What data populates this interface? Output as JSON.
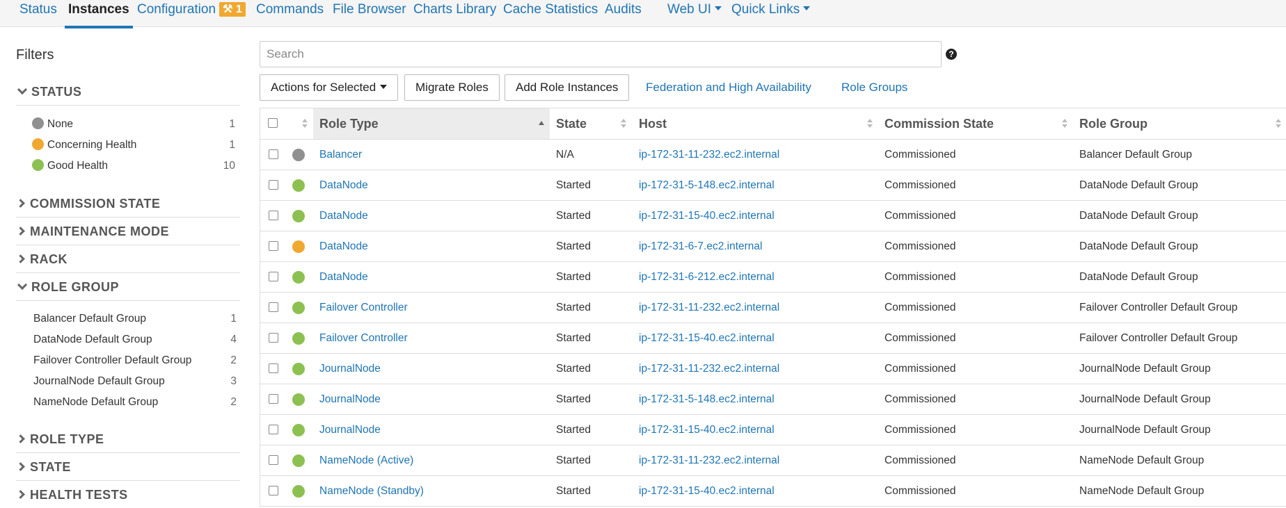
{
  "nav": {
    "tabs": [
      {
        "label": "Status"
      },
      {
        "label": "Instances"
      },
      {
        "label": "Configuration",
        "badge": "1"
      },
      {
        "label": "Commands"
      },
      {
        "label": "File Browser"
      },
      {
        "label": "Charts Library"
      },
      {
        "label": "Cache Statistics"
      },
      {
        "label": "Audits"
      },
      {
        "label": "Web UI"
      },
      {
        "label": "Quick Links"
      }
    ]
  },
  "filters": {
    "title": "Filters",
    "sections": [
      {
        "label": "STATUS"
      },
      {
        "label": "COMMISSION STATE"
      },
      {
        "label": "MAINTENANCE MODE"
      },
      {
        "label": "RACK"
      },
      {
        "label": "ROLE GROUP"
      },
      {
        "label": "ROLE TYPE"
      },
      {
        "label": "STATE"
      },
      {
        "label": "HEALTH TESTS"
      }
    ],
    "status_items": [
      {
        "label": "None",
        "count": "1"
      },
      {
        "label": "Concerning Health",
        "count": "1"
      },
      {
        "label": "Good Health",
        "count": "10"
      }
    ],
    "role_group_items": [
      {
        "label": "Balancer Default Group",
        "count": "1"
      },
      {
        "label": "DataNode Default Group",
        "count": "4"
      },
      {
        "label": "Failover Controller Default Group",
        "count": "2"
      },
      {
        "label": "JournalNode Default Group",
        "count": "3"
      },
      {
        "label": "NameNode Default Group",
        "count": "2"
      }
    ]
  },
  "search": {
    "placeholder": "Search"
  },
  "toolbar": {
    "actions_label": "Actions for Selected",
    "migrate_label": "Migrate Roles",
    "add_label": "Add Role Instances",
    "federation_label": "Federation and High Availability",
    "role_groups_label": "Role Groups"
  },
  "table": {
    "headers": {
      "role_type": "Role Type",
      "state": "State",
      "host": "Host",
      "commission_state": "Commission State",
      "role_group": "Role Group"
    },
    "rows": [
      {
        "status": "none",
        "role_type": "Balancer",
        "state": "N/A",
        "host": "ip-172-31-11-232.ec2.internal",
        "commission_state": "Commissioned",
        "role_group": "Balancer Default Group"
      },
      {
        "status": "good",
        "role_type": "DataNode",
        "state": "Started",
        "host": "ip-172-31-5-148.ec2.internal",
        "commission_state": "Commissioned",
        "role_group": "DataNode Default Group"
      },
      {
        "status": "good",
        "role_type": "DataNode",
        "state": "Started",
        "host": "ip-172-31-15-40.ec2.internal",
        "commission_state": "Commissioned",
        "role_group": "DataNode Default Group"
      },
      {
        "status": "concerning",
        "role_type": "DataNode",
        "state": "Started",
        "host": "ip-172-31-6-7.ec2.internal",
        "commission_state": "Commissioned",
        "role_group": "DataNode Default Group"
      },
      {
        "status": "good",
        "role_type": "DataNode",
        "state": "Started",
        "host": "ip-172-31-6-212.ec2.internal",
        "commission_state": "Commissioned",
        "role_group": "DataNode Default Group"
      },
      {
        "status": "good",
        "role_type": "Failover Controller",
        "state": "Started",
        "host": "ip-172-31-11-232.ec2.internal",
        "commission_state": "Commissioned",
        "role_group": "Failover Controller Default Group"
      },
      {
        "status": "good",
        "role_type": "Failover Controller",
        "state": "Started",
        "host": "ip-172-31-15-40.ec2.internal",
        "commission_state": "Commissioned",
        "role_group": "Failover Controller Default Group"
      },
      {
        "status": "good",
        "role_type": "JournalNode",
        "state": "Started",
        "host": "ip-172-31-11-232.ec2.internal",
        "commission_state": "Commissioned",
        "role_group": "JournalNode Default Group"
      },
      {
        "status": "good",
        "role_type": "JournalNode",
        "state": "Started",
        "host": "ip-172-31-5-148.ec2.internal",
        "commission_state": "Commissioned",
        "role_group": "JournalNode Default Group"
      },
      {
        "status": "good",
        "role_type": "JournalNode",
        "state": "Started",
        "host": "ip-172-31-15-40.ec2.internal",
        "commission_state": "Commissioned",
        "role_group": "JournalNode Default Group"
      },
      {
        "status": "good",
        "role_type": "NameNode (Active)",
        "state": "Started",
        "host": "ip-172-31-11-232.ec2.internal",
        "commission_state": "Commissioned",
        "role_group": "NameNode Default Group"
      },
      {
        "status": "good",
        "role_type": "NameNode (Standby)",
        "state": "Started",
        "host": "ip-172-31-15-40.ec2.internal",
        "commission_state": "Commissioned",
        "role_group": "NameNode Default Group"
      }
    ]
  },
  "colors": {
    "link": "#1f75b4",
    "status_none": "#909090",
    "status_concerning": "#f0a830",
    "status_good": "#8cc152",
    "badge": "#f0a830"
  }
}
